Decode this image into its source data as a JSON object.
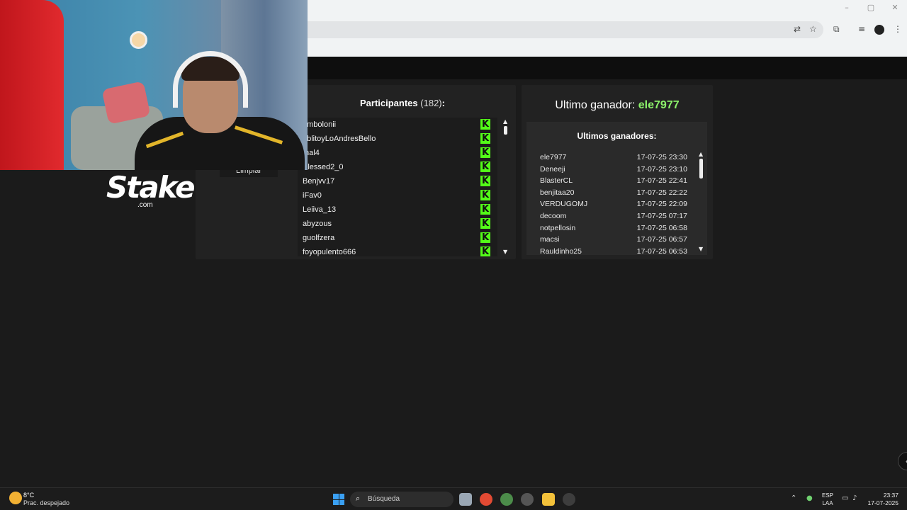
{
  "browser": {
    "window_controls": [
      "–",
      "▢",
      "✕"
    ]
  },
  "participants": {
    "title": "Participantes",
    "count": "(182)",
    "colon": ":",
    "clear_label": "Limpiar",
    "badge_letter": "K",
    "items": [
      "embolonii",
      "ablitoyLoAndresBello",
      "mal4",
      "Blessed2_0",
      "Benjvv17",
      "iFav0",
      "Leiiva_13",
      "abyzous",
      "guolfzera",
      "foyopulento666"
    ]
  },
  "last_winner": {
    "label": "Ultimo ganador:",
    "name": "ele7977"
  },
  "winners": {
    "title": "Ultimos ganadores:",
    "rows": [
      {
        "name": "ele7977",
        "date": "17-07-25 23:30"
      },
      {
        "name": "Deneeji",
        "date": "17-07-25 23:10"
      },
      {
        "name": "BlasterCL",
        "date": "17-07-25 22:41"
      },
      {
        "name": "benjitaa20",
        "date": "17-07-25 22:22"
      },
      {
        "name": "VERDUGOMJ",
        "date": "17-07-25 22:09"
      },
      {
        "name": "decoom",
        "date": "17-07-25 07:17"
      },
      {
        "name": "notpellosin",
        "date": "17-07-25 06:58"
      },
      {
        "name": "macsi",
        "date": "17-07-25 06:57"
      },
      {
        "name": "Rauldinho25",
        "date": "17-07-25 06:53"
      }
    ]
  },
  "stake": {
    "word": "Stake",
    "domain": ".com"
  },
  "taskbar": {
    "weather_temp": "8°C",
    "weather_desc": "Prac. despejado",
    "search_placeholder": "Búsqueda",
    "lang_top": "ESP",
    "lang_bottom": "LAA",
    "time": "23:37",
    "date": "17-07-2025"
  },
  "colors": {
    "kick_green": "#53fc18",
    "winner_green": "#8df36b",
    "panel": "#222222"
  }
}
